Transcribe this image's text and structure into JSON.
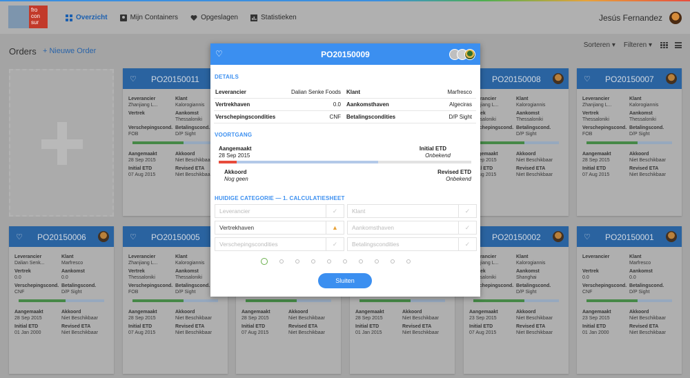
{
  "logo": {
    "lines": [
      "fro",
      "con",
      "sur"
    ]
  },
  "nav": [
    {
      "label": "Overzicht",
      "icon": "dashboard-icon",
      "active": true
    },
    {
      "label": "Mijn Containers",
      "icon": "containers-icon",
      "active": false
    },
    {
      "label": "Opgeslagen",
      "icon": "heart-icon",
      "active": false
    },
    {
      "label": "Statistieken",
      "icon": "chart-icon",
      "active": false
    }
  ],
  "user": {
    "name": "Jesús Fernandez"
  },
  "orders": {
    "title": "Orders",
    "new_label": "+ Nieuwe Order",
    "sort_label": "Sorteren ▾",
    "filter_label": "Filteren ▾"
  },
  "labels": {
    "leverancier": "Leverancier",
    "klant": "Klant",
    "vertrek": "Vertrek",
    "aankomst": "Aankomst",
    "verscheping": "Verschepingscond.",
    "betaling": "Betalingscond.",
    "aangemaakt": "Aangemaakt",
    "akkoord": "Akkoord",
    "initial_etd": "Initial ETD",
    "revised_eta": "Revised ETA"
  },
  "cards": [
    {
      "id": "PO20150011",
      "lev": "Zhanjiang L...",
      "klant": "Kalorogiannis",
      "vertrek": "",
      "aankomst": "Thessaloniki",
      "aankomst2": "Thessaloniki",
      "vers": "FOB",
      "bet": "D/P Sight",
      "progress": 0.6,
      "aangemaakt": "28 Sep 2015",
      "akkoord": "Niet Beschikbaar",
      "etd": "07 Aug 2015",
      "eta": "Niet Beschikbaar"
    },
    {
      "id": "PO20150008",
      "lev": "Zhanjiang L...",
      "klant": "Kalorogiannis",
      "vertrek": "Thessaloniki",
      "aankomst": "Thessaloniki",
      "vers": "FOB",
      "bet": "D/P Sight",
      "progress": 0.6,
      "aangemaakt": "28 Sep 2015",
      "akkoord": "Niet Beschikbaar",
      "etd": "07 Aug 2015",
      "eta": "Niet Beschikbaar"
    },
    {
      "id": "PO20150007",
      "lev": "Zhanjiang L...",
      "klant": "Kalorogiannis",
      "vertrek": "Thessaloniki",
      "aankomst": "Thessaloniki",
      "vers": "FOB",
      "bet": "D/P Sight",
      "progress": 0.6,
      "aangemaakt": "28 Sep 2015",
      "akkoord": "Niet Beschikbaar",
      "etd": "07 Aug 2015",
      "eta": "Niet Beschikbaar"
    },
    {
      "id": "PO20150006",
      "lev": "Dalian Senk...",
      "klant": "Marfresco",
      "vertrek": "0.0",
      "aankomst": "0.0",
      "vers": "CNF",
      "bet": "D/P Sight",
      "progress": 0.55,
      "aangemaakt": "28 Sep 2015",
      "akkoord": "Niet Beschikbaar",
      "etd": "01 Jan 2000",
      "eta": "Niet Beschikbaar"
    },
    {
      "id": "PO20150005",
      "lev": "Zhanjiang L...",
      "klant": "Kalorogiannis",
      "vertrek": "Thessaloniki",
      "aankomst": "Thessaloniki",
      "vers": "FOB",
      "bet": "D/P Sight",
      "progress": 0.6,
      "aangemaakt": "28 Sep 2015",
      "akkoord": "Niet Beschikbaar",
      "etd": "07 Aug 2015",
      "eta": "Niet Beschikbaar"
    },
    {
      "id": "PO20150002",
      "lev": "Zhanjiang L...",
      "klant": "Kalorogiannis",
      "vertrek": "Thessaloniki",
      "aankomst": "Shanghai",
      "vers": "FOB",
      "bet": "D/P Sight",
      "progress": 0.6,
      "aangemaakt": "23 Sep 2015",
      "akkoord": "Niet Beschikbaar",
      "etd": "07 Aug 2015",
      "eta": "Niet Beschikbaar"
    },
    {
      "id": "PO20150001",
      "lev": "",
      "klant": "Marfresco",
      "vertrek": "0.0",
      "aankomst": "0.0",
      "vers": "CNF",
      "bet": "D/P Sight",
      "progress": 0.6,
      "aangemaakt": "23 Sep 2015",
      "akkoord": "Niet Beschikbaar",
      "etd": "01 Jan 2000",
      "eta": "Niet Beschikbaar"
    },
    {
      "id": "",
      "lev": "",
      "klant": "",
      "vertrek": "",
      "aankomst": "",
      "vers": "",
      "bet": "",
      "progress": 0.6,
      "aangemaakt": "28 Sep 2015",
      "akkoord": "Niet Beschikbaar",
      "etd": "07 Aug 2015",
      "eta": "Niet Beschikbaar"
    },
    {
      "id": "",
      "lev": "",
      "klant": "",
      "vertrek": "",
      "aankomst": "",
      "vers": "",
      "bet": "",
      "progress": 0.6,
      "aangemaakt": "28 Sep 2015",
      "akkoord": "Niet Beschikbaar",
      "etd": "01 Jan 2015",
      "eta": "Niet Beschikbaar"
    }
  ],
  "modal": {
    "title": "PO20150009",
    "details_label": "DETAILS",
    "details": [
      {
        "k1": "Leverancier",
        "v1": "Dalian Senke Foods",
        "k2": "Klant",
        "v2": "Marfresco"
      },
      {
        "k1": "Vertrekhaven",
        "v1": "0.0",
        "k2": "Aankomsthaven",
        "v2": "Algeciras"
      },
      {
        "k1": "Verschepingscondities",
        "v1": "CNF",
        "k2": "Betalingscondities",
        "v2": "D/P Sight"
      }
    ],
    "progress_label": "VOORTGANG",
    "aangemaakt": "Aangemaakt",
    "aangemaakt_date": "28 Sep 2015",
    "initial_etd": "Initial ETD",
    "initial_etd_val": "Onbekend",
    "akkoord": "Akkoord",
    "akkoord_val": "Nog geen",
    "revised_etd": "Revised ETD",
    "revised_etd_val": "Onbekend",
    "progress_red": 0.07,
    "progress_blue": 0.63,
    "category_label": "HUIDIGE CATEGORIE — 1. CALCULATIESHEET",
    "fields": [
      {
        "label": "Leverancier",
        "label2": "Klant"
      },
      {
        "label": "Vertrekhaven",
        "label2": "Aankomsthaven"
      },
      {
        "label": "Verschepingscondities",
        "label2": "Betalingscondities"
      }
    ],
    "steps": 10,
    "active_step": 0,
    "close_label": "Sluiten"
  },
  "colors": {
    "accent": "#3b8ff0",
    "card_header": "#1c5ea6",
    "progress_green": "#4caf50",
    "progress_red": "#e74c3c"
  }
}
